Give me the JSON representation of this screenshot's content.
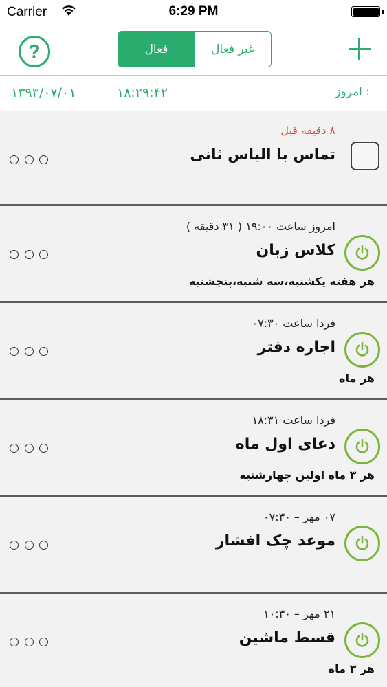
{
  "status_bar": {
    "carrier": "Carrier",
    "time": "6:29 PM"
  },
  "nav": {
    "help_label": "?",
    "segments": [
      {
        "label": "غیر فعال",
        "selected": false
      },
      {
        "label": "فعال",
        "selected": true
      }
    ],
    "accent_color": "#2aad6f"
  },
  "today": {
    "label": "امروز :",
    "time": "۱۸:۲۹:۴۲",
    "date": "۱۳۹۳/۰۷/۰۱"
  },
  "reminders": [
    {
      "icon": "checkbox-icon",
      "meta": "۸ دقیقه قبل",
      "meta_color": "#e2453b",
      "title": "تماس با الیاس ثانی",
      "repeat": ""
    },
    {
      "icon": "power-icon",
      "meta": "امروز ساعت ۱۹:۰۰ ( ۳۱ دقیقه )",
      "title": "کلاس زبان",
      "repeat": "هر هفته یکشنبه،سه شنبه،پنجشنبه"
    },
    {
      "icon": "power-icon",
      "meta": "فردا ساعت ۰۷:۳۰",
      "title": "اجاره دفتر",
      "repeat": "هر ماه"
    },
    {
      "icon": "power-icon",
      "meta": "فردا ساعت ۱۸:۳۱",
      "title": "دعای اول ماه",
      "repeat": "هر ۳ ماه اولین چهارشنبه"
    },
    {
      "icon": "power-icon",
      "meta": "۰۷ مهر – ۰۷:۳۰",
      "title": "موعد چک افشار",
      "repeat": ""
    },
    {
      "icon": "power-icon",
      "meta": "۲۱ مهر – ۱۰:۳۰",
      "title": "قسط ماشین",
      "repeat": "هر ۳ ماه"
    }
  ]
}
